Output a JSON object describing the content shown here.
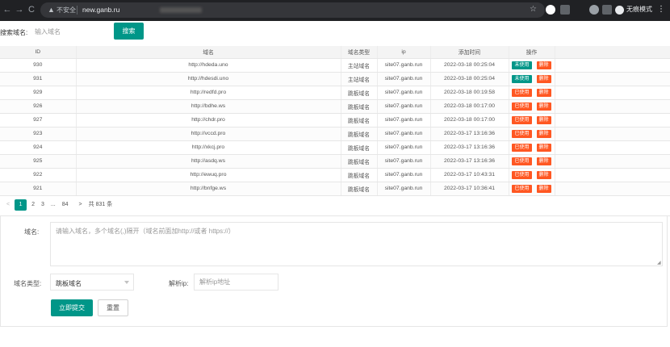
{
  "browser": {
    "back_icon": "←",
    "forward_icon": "→",
    "reload_icon": "C",
    "warning_icon": "▲",
    "insecure_label": "不安全",
    "url": "new.ganb.ru",
    "star_icon": "☆",
    "incognito_label": "无痕模式",
    "menu_icon": "⋮"
  },
  "search": {
    "label": "搜索域名:",
    "placeholder": "输入域名",
    "button_label": "搜索"
  },
  "table": {
    "columns": [
      "ID",
      "域名",
      "域名类型",
      "ip",
      "添加时间",
      "操作"
    ],
    "delete_label": "删除",
    "rows": [
      {
        "id": "930",
        "domain": "http://hdeda.uno",
        "type": "主站域名",
        "ip": "site07.ganb.run",
        "time": "2022-03-18 00:25:04",
        "status": "未使用",
        "used": false
      },
      {
        "id": "931",
        "domain": "http://hdesdi.uno",
        "type": "主站域名",
        "ip": "site07.ganb.run",
        "time": "2022-03-18 00:25:04",
        "status": "未使用",
        "used": false
      },
      {
        "id": "929",
        "domain": "http://redfd.pro",
        "type": "跳板域名",
        "ip": "site07.ganb.run",
        "time": "2022-03-18 00:19:58",
        "status": "已使用",
        "used": true
      },
      {
        "id": "926",
        "domain": "http://bdhe.ws",
        "type": "跳板域名",
        "ip": "site07.ganb.run",
        "time": "2022-03-18 00:17:00",
        "status": "已使用",
        "used": true
      },
      {
        "id": "927",
        "domain": "http://chdr.pro",
        "type": "跳板域名",
        "ip": "site07.ganb.run",
        "time": "2022-03-18 00:17:00",
        "status": "已使用",
        "used": true
      },
      {
        "id": "923",
        "domain": "http://vccd.pro",
        "type": "跳板域名",
        "ip": "site07.ganb.run",
        "time": "2022-03-17 13:16:36",
        "status": "已使用",
        "used": true
      },
      {
        "id": "924",
        "domain": "http://xkcj.pro",
        "type": "跳板域名",
        "ip": "site07.ganb.run",
        "time": "2022-03-17 13:16:36",
        "status": "已使用",
        "used": true
      },
      {
        "id": "925",
        "domain": "http://asdq.ws",
        "type": "跳板域名",
        "ip": "site07.ganb.run",
        "time": "2022-03-17 13:16:36",
        "status": "已使用",
        "used": true
      },
      {
        "id": "922",
        "domain": "http://ewuq.pro",
        "type": "跳板域名",
        "ip": "site07.ganb.run",
        "time": "2022-03-17 10:43:31",
        "status": "已使用",
        "used": true
      },
      {
        "id": "921",
        "domain": "http://bnfge.ws",
        "type": "跳板域名",
        "ip": "site07.ganb.run",
        "time": "2022-03-17 10:36:41",
        "status": "已使用",
        "used": true
      }
    ]
  },
  "pagination": {
    "prev_icon": "<",
    "pages": [
      "1",
      "2",
      "3"
    ],
    "ellipsis": "...",
    "last_page": "84",
    "next_icon": ">",
    "total_text": "共 831 条"
  },
  "form": {
    "domain_label": "域名:",
    "domain_placeholder": "请输入域名，多个域名(,)隔开（域名前面加http://或者 https://）",
    "type_label": "域名类型:",
    "type_value": "跳板域名",
    "ip_label": "解析ip:",
    "ip_placeholder": "解析ip地址",
    "submit_label": "立即提交",
    "reset_label": "重置"
  },
  "colors": {
    "primary": "#009688",
    "danger": "#ff5722",
    "chrome_bg": "#202124"
  }
}
